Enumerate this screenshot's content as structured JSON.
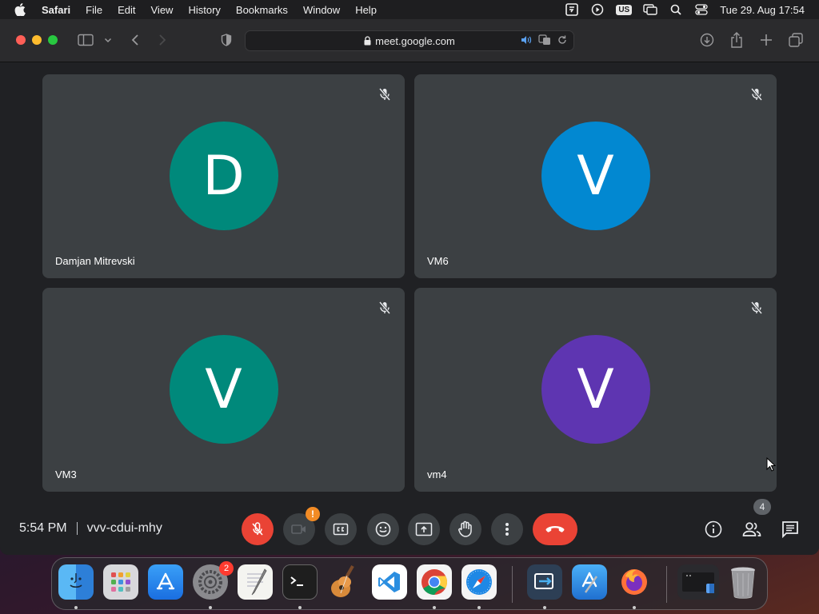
{
  "menubar": {
    "app_name": "Safari",
    "items": [
      "File",
      "Edit",
      "View",
      "History",
      "Bookmarks",
      "Window",
      "Help"
    ],
    "keyboard_layout": "US",
    "datetime": "Tue 29. Aug  17:54"
  },
  "browser": {
    "url": "meet.google.com"
  },
  "participants": [
    {
      "initial": "D",
      "name": "Damjan Mitrevski",
      "color": "#00897b"
    },
    {
      "initial": "V",
      "name": "VM6",
      "color": "#0288d1"
    },
    {
      "initial": "V",
      "name": "VM3",
      "color": "#00897b"
    },
    {
      "initial": "V",
      "name": "vm4",
      "color": "#5e35b1"
    }
  ],
  "meeting": {
    "time": "5:54 PM",
    "code": "vvv-cdui-mhy",
    "camera_warning": "!",
    "people_count": "4"
  },
  "dock": {
    "settings_badge": "2"
  }
}
